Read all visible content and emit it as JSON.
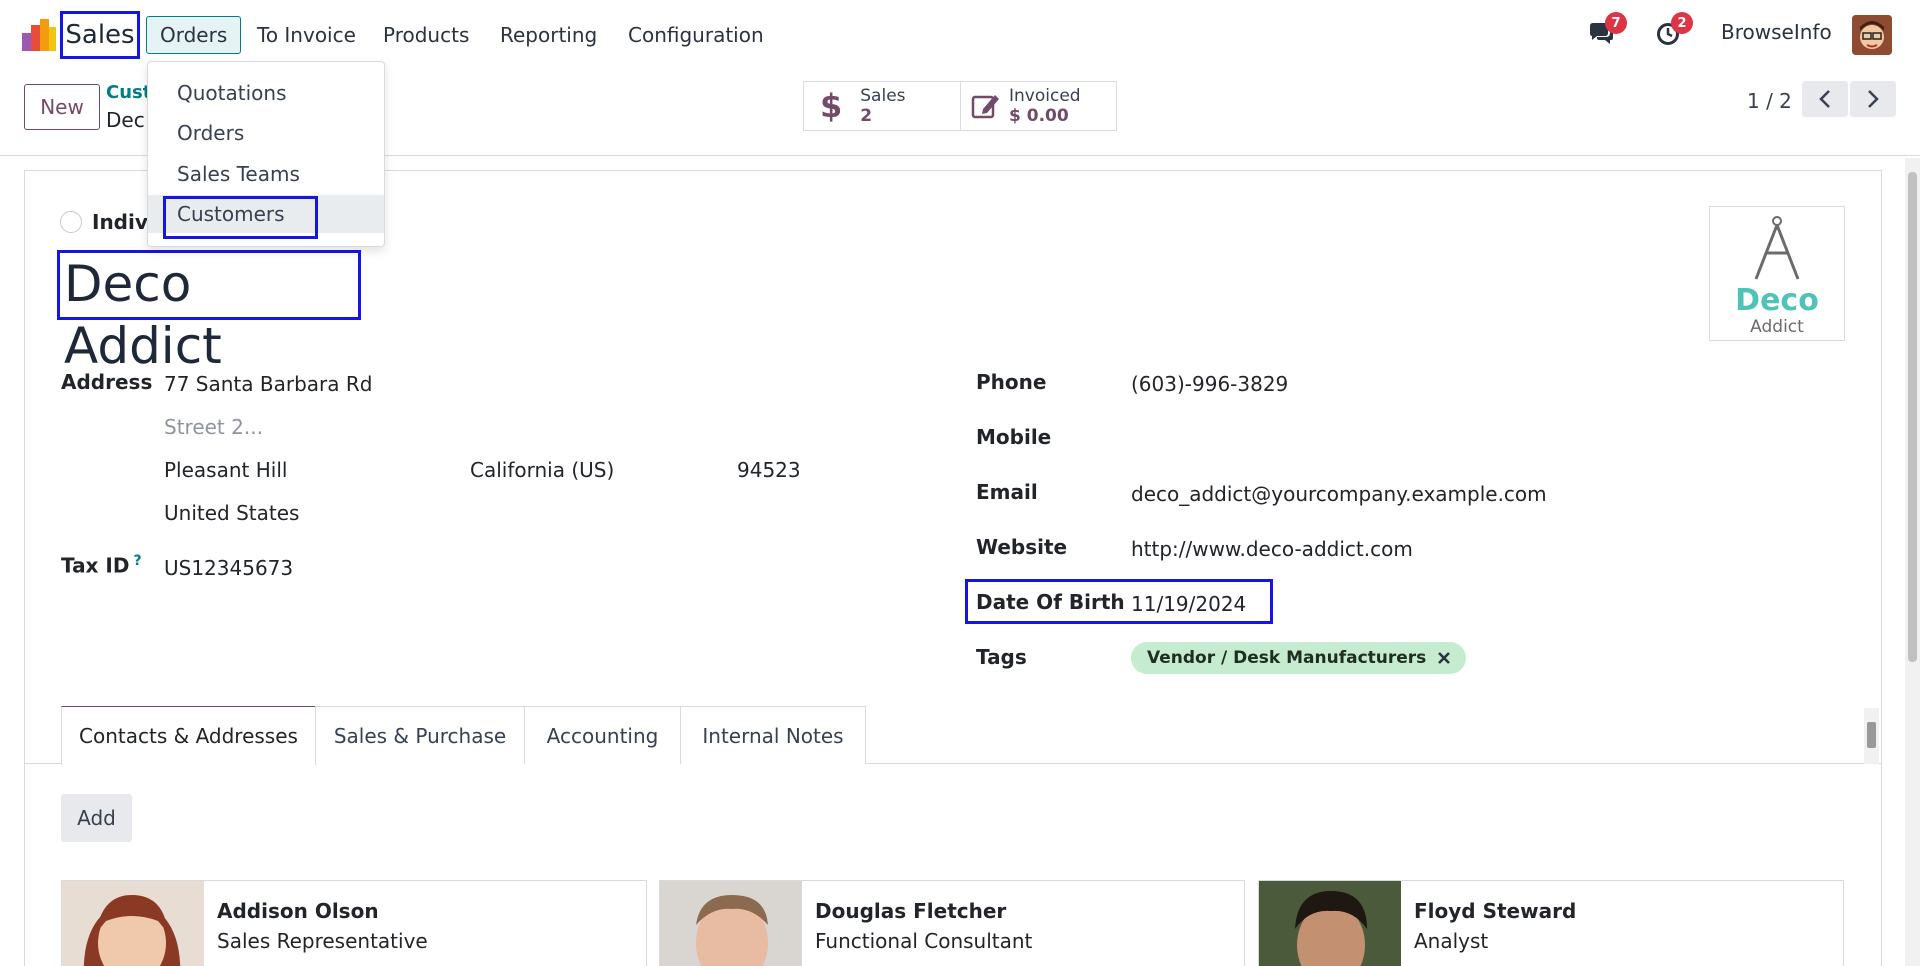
{
  "nav": {
    "brand": "Sales",
    "menu": [
      "Orders",
      "To Invoice",
      "Products",
      "Reporting",
      "Configuration"
    ],
    "messages_count": "7",
    "activities_count": "2",
    "company": "BrowseInfo"
  },
  "dropdown": {
    "items": [
      "Quotations",
      "Orders",
      "Sales Teams",
      "Customers"
    ]
  },
  "control": {
    "new_label": "New",
    "breadcrumb_parent": "Cust",
    "breadcrumb_current": "Dec",
    "stat_sales_label": "Sales",
    "stat_sales_value": "2",
    "stat_invoiced_label": "Invoiced",
    "stat_invoiced_value": "$ 0.00",
    "pager": "1 / 2"
  },
  "form": {
    "company_type_label": "Indivi",
    "name": "Deco Addict",
    "logo_text_1": "Deco",
    "logo_text_2": "Addict",
    "address_label": "Address",
    "street": "77 Santa Barbara Rd",
    "street2_placeholder": "Street 2...",
    "city": "Pleasant Hill",
    "state": "California (US)",
    "zip": "94523",
    "country": "United States",
    "tax_label": "Tax ID",
    "tax_help": "?",
    "tax_value": "US12345673",
    "phone_label": "Phone",
    "phone_value": "(603)-996-3829",
    "mobile_label": "Mobile",
    "email_label": "Email",
    "email_value": "deco_addict@yourcompany.example.com",
    "website_label": "Website",
    "website_value": "http://www.deco-addict.com",
    "dob_label": "Date Of Birth",
    "dob_value": "11/19/2024",
    "tags_label": "Tags",
    "tag": "Vendor / Desk Manufacturers"
  },
  "tabs": [
    "Contacts & Addresses",
    "Sales & Purchase",
    "Accounting",
    "Internal Notes"
  ],
  "contacts": {
    "add_label": "Add",
    "cards": [
      {
        "name": "Addison Olson",
        "role": "Sales Representative"
      },
      {
        "name": "Douglas Fletcher",
        "role": "Functional Consultant"
      },
      {
        "name": "Floyd Steward",
        "role": "Analyst"
      }
    ]
  },
  "colors": {
    "brand_purple": "#714b67",
    "accent_teal": "#017e84",
    "highlight_blue": "#1515e6",
    "tag_green": "#c5ecce",
    "badge_red": "#dc3545"
  }
}
